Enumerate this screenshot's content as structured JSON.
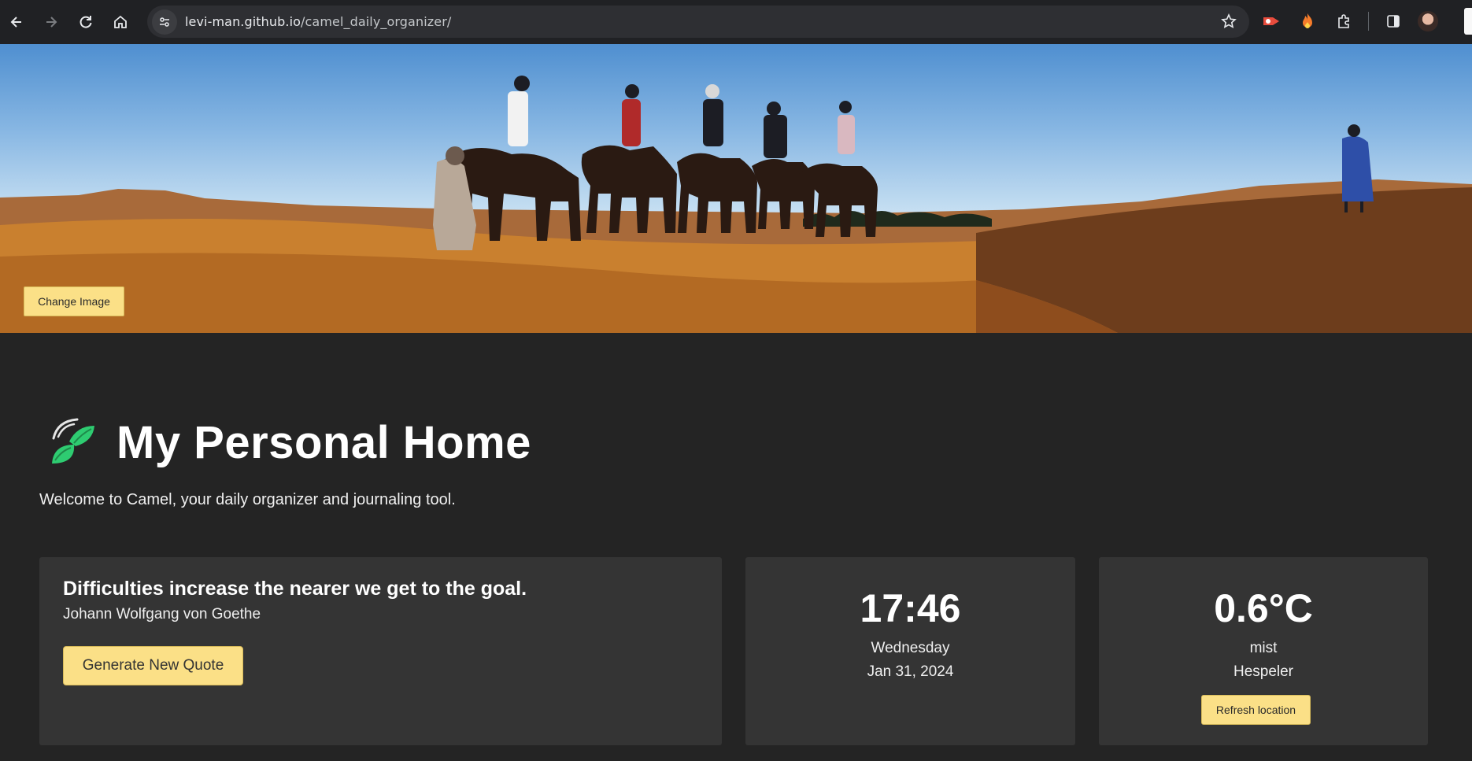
{
  "browser": {
    "url_domain": "levi-man.github.io",
    "url_path": "/camel_daily_organizer/",
    "icons": [
      "back-arrow-icon",
      "forward-arrow-icon",
      "reload-icon",
      "home-icon",
      "site-info-icon",
      "bookmark-star-icon",
      "extension-icon",
      "side-panel-icon",
      "profile-avatar"
    ]
  },
  "hero": {
    "change_image_label": "Change Image"
  },
  "header": {
    "title": "My Personal Home",
    "icon": "leaves-icon",
    "welcome": "Welcome to Camel, your daily organizer and journaling tool."
  },
  "quote_card": {
    "quote": "Difficulties increase the nearer we get to the goal.",
    "author": "Johann Wolfgang von Goethe",
    "button_label": "Generate New Quote"
  },
  "clock_card": {
    "time": "17:46",
    "weekday": "Wednesday",
    "date": "Jan 31, 2024"
  },
  "weather_card": {
    "temperature": "0.6°C",
    "condition": "mist",
    "location": "Hespeler",
    "button_label": "Refresh location"
  },
  "colors": {
    "page_bg": "#242424",
    "card_bg": "#343434",
    "button_bg": "#fbe087",
    "leaf_green": "#2ecc71"
  }
}
